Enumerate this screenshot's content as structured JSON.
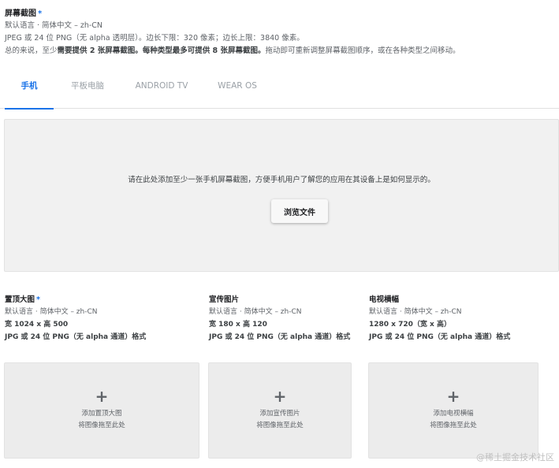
{
  "screenshots": {
    "title": "屏幕截图",
    "required_mark": "*",
    "line1": "默认语言 · 简体中文 – zh-CN",
    "line2": "JPEG 或 24 位 PNG（无 alpha 透明层）。边长下限：320 像素；边长上限：3840 像素。",
    "line3_a": "总的来说，至少",
    "line3_b": "需要提供 2 张屏幕截图。每种类型最多可提供 8 张屏幕截图。",
    "line3_c": "拖动即可重新调整屏幕截图顺序，或在各种类型之间移动。"
  },
  "tabs": [
    {
      "label": "手机"
    },
    {
      "label": "平板电脑"
    },
    {
      "label": "ANDROID TV"
    },
    {
      "label": "WEAR OS"
    }
  ],
  "dropzone": {
    "text": "请在此处添加至少一张手机屏幕截图，方便手机用户了解您的应用在其设备上是如何显示的。",
    "button": "浏览文件"
  },
  "assets": [
    {
      "title": "置顶大图",
      "required_mark": "*",
      "lang": "默认语言 · 简体中文 – zh-CN",
      "size": "宽 1024 x 高 500",
      "format": "JPG 或 24 位 PNG（无 alpha 通道）格式",
      "tile_label": "添加置顶大图",
      "tile_hint": "将图像拖至此处"
    },
    {
      "title": "宣传图片",
      "required_mark": "",
      "lang": "默认语言 · 简体中文 – zh-CN",
      "size": "宽 180 x 高 120",
      "format": "JPG 或 24 位 PNG（无 alpha 通道）格式",
      "tile_label": "添加宣传图片",
      "tile_hint": "将图像拖至此处"
    },
    {
      "title": "电视横幅",
      "required_mark": "",
      "lang": "默认语言 · 简体中文 – zh-CN",
      "size": "1280 x 720（宽 x 高）",
      "format": "JPG 或 24 位 PNG（无 alpha 通道）格式",
      "tile_label": "添加电视横幅",
      "tile_hint": "将图像拖至此处"
    }
  ],
  "tile_plus": "+",
  "watermark": "@稀土掘金技术社区",
  "colors": {
    "accent": "#1a73e8",
    "dropzone_bg": "#f1f1f1",
    "tile_bg": "#ececec"
  }
}
